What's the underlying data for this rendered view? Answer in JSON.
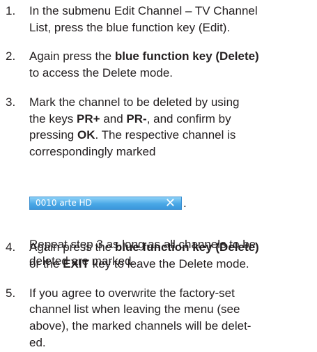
{
  "steps": [
    {
      "number": "1.",
      "lines": [
        [
          {
            "t": "In the submenu Edit Channel – TV Channel"
          }
        ],
        [
          {
            "t": "List, press the blue function key (Edit)."
          }
        ]
      ]
    },
    {
      "number": "2.",
      "lines": [
        [
          {
            "t": "Again press the "
          },
          {
            "t": "blue function key (Delete)",
            "b": true
          }
        ],
        [
          {
            "t": "to access the Delete mode."
          }
        ]
      ]
    },
    {
      "number": "3.",
      "lines": [
        [
          {
            "t": "Mark the channel to be deleted by using"
          }
        ],
        [
          {
            "t": "the keys "
          },
          {
            "t": "PR+",
            "b": true
          },
          {
            "t": " and "
          },
          {
            "t": "PR-",
            "b": true
          },
          {
            "t": ", and confirm by"
          }
        ],
        [
          {
            "t": "pressing "
          },
          {
            "t": "OK",
            "b": true
          },
          {
            "t": ". The respective channel is"
          }
        ],
        [
          {
            "t": "correspondingly marked"
          }
        ]
      ],
      "after_bar_lines": [
        [
          {
            "t": "Repeat step 3 as long as all channels to be"
          }
        ],
        [
          {
            "t": "deleted are marked."
          }
        ]
      ]
    },
    {
      "number": "4.",
      "lines": [
        [
          {
            "t": "Again press the "
          },
          {
            "t": "blue function key (Delete)",
            "b": true
          }
        ],
        [
          {
            "t": "or the "
          },
          {
            "t": "EXIT",
            "b": true
          },
          {
            "t": " key to leave the Delete mode."
          }
        ]
      ]
    },
    {
      "number": "5.",
      "lines": [
        [
          {
            "t": "If you agree to overwrite the factory-set"
          }
        ],
        [
          {
            "t": "channel list when leaving the menu (see"
          }
        ],
        [
          {
            "t": "above), the marked channels will be delet-"
          }
        ],
        [
          {
            "t": "ed."
          }
        ]
      ]
    }
  ],
  "channel_bar": {
    "label": "0010 arte HD",
    "icon": "close-x-icon",
    "icon_glyph": "✕",
    "trailing": "."
  },
  "colors": {
    "text": "#231f20",
    "bar_top": "#8ed2f8",
    "bar_bottom": "#3a97dc"
  }
}
